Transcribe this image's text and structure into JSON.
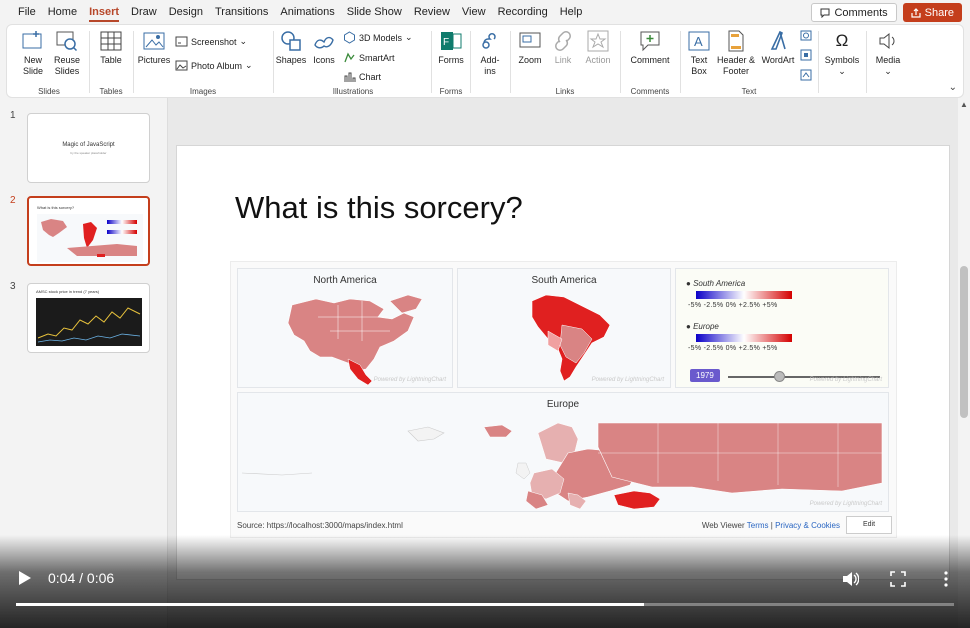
{
  "menu": {
    "tabs": [
      "File",
      "Home",
      "Insert",
      "Draw",
      "Design",
      "Transitions",
      "Animations",
      "Slide Show",
      "Review",
      "View",
      "Recording",
      "Help"
    ],
    "active_tab": "Insert",
    "comments_label": "Comments",
    "share_label": "Share"
  },
  "ribbon": {
    "slides": {
      "label": "Slides",
      "new_slide": "New Slide",
      "reuse_slides": "Reuse Slides"
    },
    "tables": {
      "label": "Tables",
      "table": "Table"
    },
    "images": {
      "label": "Images",
      "pictures": "Pictures",
      "screenshot": "Screenshot",
      "photo_album": "Photo Album"
    },
    "illustrations": {
      "label": "Illustrations",
      "shapes": "Shapes",
      "icons": "Icons",
      "models_3d": "3D Models",
      "smartart": "SmartArt",
      "chart": "Chart"
    },
    "forms": {
      "label": "Forms",
      "forms": "Forms"
    },
    "addins": {
      "label": "",
      "addins": "Add-ins"
    },
    "links": {
      "label": "Links",
      "zoom": "Zoom",
      "link": "Link",
      "action": "Action"
    },
    "comments": {
      "label": "Comments",
      "comment": "Comment"
    },
    "text": {
      "label": "Text",
      "text_box": "Text Box",
      "header_footer": "Header & Footer",
      "wordart": "WordArt"
    },
    "symbols": {
      "symbols": "Symbols"
    },
    "media": {
      "media": "Media"
    }
  },
  "slides_panel": {
    "slides": [
      {
        "number": "1",
        "title": "Magic of JavaScript",
        "subtitle": "by the speaker placeholder"
      },
      {
        "number": "2",
        "title": "What is this sorcery?"
      },
      {
        "number": "3",
        "title": "AMSC stock price in trend (7 years)"
      }
    ]
  },
  "slide": {
    "title": "What is this sorcery?",
    "embed": {
      "maps": {
        "north_america": "North America",
        "south_america": "South America",
        "europe": "Europe"
      },
      "legend": {
        "items": [
          "South America",
          "Europe"
        ],
        "ticks": "-5%  -2.5%  0%  +2.5% +5%"
      },
      "year": "1979",
      "watermark": "Powered by LightningChart",
      "source": "Source: https://localhost:3000/maps/index.html",
      "viewer": {
        "prefix": "Web Viewer",
        "terms": "Terms",
        "sep": "|",
        "privacy": "Privacy & Cookies"
      },
      "edit": "Edit"
    }
  },
  "video": {
    "time": "0:04 / 0:06",
    "progress": 0.67,
    "buffered": 0.67
  }
}
